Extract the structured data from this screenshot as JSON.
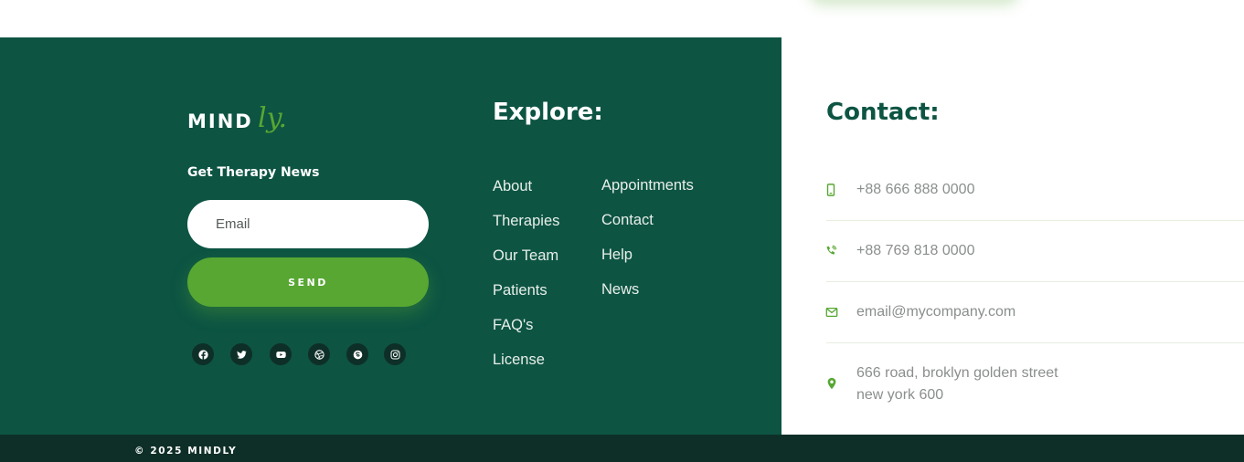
{
  "brand": {
    "logo_main": "MIND",
    "logo_script": "ly."
  },
  "newsletter": {
    "title": "Get Therapy News",
    "email_placeholder": "Email",
    "send_label": "SEND"
  },
  "socials": [
    "facebook-icon",
    "twitter-icon",
    "youtube-icon",
    "dribbble-icon",
    "skype-icon",
    "instagram-icon"
  ],
  "explore": {
    "title": "Explore:",
    "col1": [
      "About",
      "Therapies",
      "Our Team",
      "Patients",
      "FAQ's",
      "License"
    ],
    "col2": [
      "Appointments",
      "Contact",
      "Help",
      "News"
    ]
  },
  "contact": {
    "title": "Contact:",
    "phone": "+88 666 888 0000",
    "phone2": "+88 769 818 0000",
    "email": "email@mycompany.com",
    "address_line1": "666 road, broklyn golden street",
    "address_line2": "new york 600"
  },
  "footer": {
    "copyright": "© 2025 MINDLY"
  },
  "colors": {
    "primary_green": "#0d5443",
    "accent_green": "#57a732",
    "dark_bar": "#0e2f27"
  }
}
